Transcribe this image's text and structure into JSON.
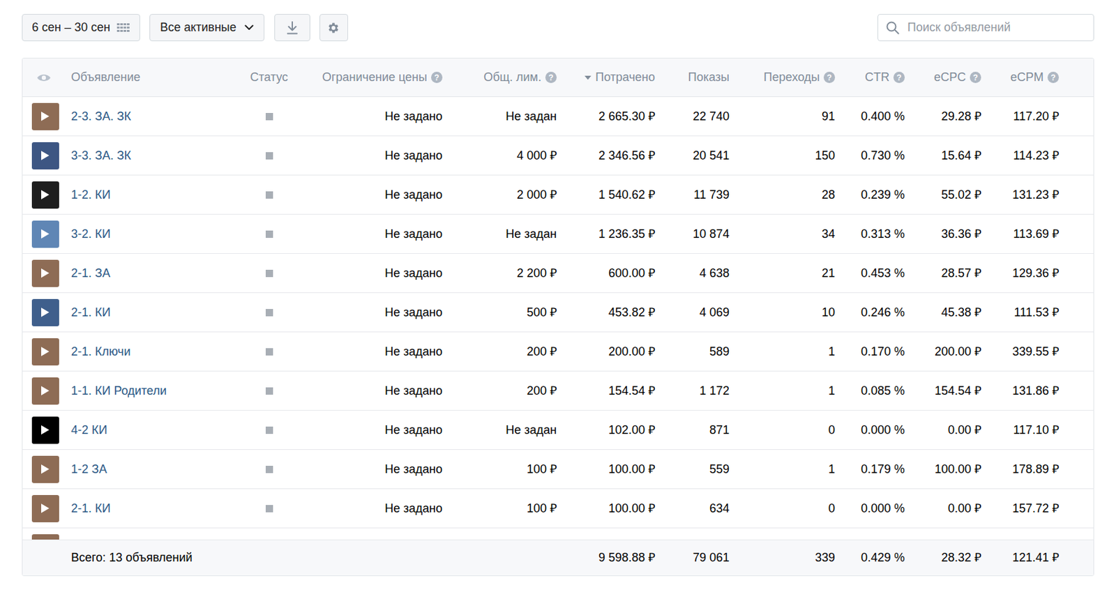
{
  "toolbar": {
    "date_range": "6 сен – 30 сен",
    "filter": "Все активные",
    "search_placeholder": "Поиск объявлений"
  },
  "table": {
    "columns": [
      {
        "label": "",
        "help": null,
        "sorted": false
      },
      {
        "label": "Объявление",
        "help": null,
        "sorted": false
      },
      {
        "label": "Статус",
        "help": null,
        "sorted": false
      },
      {
        "label": "Ограничение цены",
        "help": "?",
        "sorted": false
      },
      {
        "label": "Общ. лим.",
        "help": "?",
        "sorted": false
      },
      {
        "label": "Потрачено",
        "help": null,
        "sorted": true
      },
      {
        "label": "Показы",
        "help": null,
        "sorted": false
      },
      {
        "label": "Переходы",
        "help": "?",
        "sorted": false
      },
      {
        "label": "CTR",
        "help": "?",
        "sorted": false
      },
      {
        "label": "eCPC",
        "help": "?",
        "sorted": false
      },
      {
        "label": "eCPM",
        "help": "?",
        "sorted": false
      }
    ],
    "rows": [
      {
        "thumb_color": "#8e6c55",
        "name": "2-3. ЗА. ЗК",
        "status": "inactive",
        "price_limit": "Не задано",
        "total_limit": "Не задан",
        "spent": "2 665.30 ₽",
        "shows": "22 740",
        "clicks": "91",
        "ctr": "0.400 %",
        "ecpc": "29.28 ₽",
        "ecpm": "117.20 ₽"
      },
      {
        "thumb_color": "#3d5683",
        "name": "3-3. ЗА. ЗК",
        "status": "inactive",
        "price_limit": "Не задано",
        "total_limit": "4 000 ₽",
        "spent": "2 346.56 ₽",
        "shows": "20 541",
        "clicks": "150",
        "ctr": "0.730 %",
        "ecpc": "15.64 ₽",
        "ecpm": "114.23 ₽"
      },
      {
        "thumb_color": "#1e1e1e",
        "name": "1-2. КИ",
        "status": "inactive",
        "price_limit": "Не задано",
        "total_limit": "2 000 ₽",
        "spent": "1 540.62 ₽",
        "shows": "11 739",
        "clicks": "28",
        "ctr": "0.239 %",
        "ecpc": "55.02 ₽",
        "ecpm": "131.23 ₽"
      },
      {
        "thumb_color": "#5f86b5",
        "name": "3-2. КИ",
        "status": "inactive",
        "price_limit": "Не задано",
        "total_limit": "Не задан",
        "spent": "1 236.35 ₽",
        "shows": "10 874",
        "clicks": "34",
        "ctr": "0.313 %",
        "ecpc": "36.36 ₽",
        "ecpm": "113.69 ₽"
      },
      {
        "thumb_color": "#8e6c55",
        "name": "2-1. ЗА",
        "status": "inactive",
        "price_limit": "Не задано",
        "total_limit": "2 200 ₽",
        "spent": "600.00 ₽",
        "shows": "4 638",
        "clicks": "21",
        "ctr": "0.453 %",
        "ecpc": "28.57 ₽",
        "ecpm": "129.36 ₽"
      },
      {
        "thumb_color": "#3f5f8c",
        "name": "2-1. КИ",
        "status": "inactive",
        "price_limit": "Не задано",
        "total_limit": "500 ₽",
        "spent": "453.82 ₽",
        "shows": "4 069",
        "clicks": "10",
        "ctr": "0.246 %",
        "ecpc": "45.38 ₽",
        "ecpm": "111.53 ₽"
      },
      {
        "thumb_color": "#8e6c55",
        "name": "2-1. Ключи",
        "status": "inactive",
        "price_limit": "Не задано",
        "total_limit": "200 ₽",
        "spent": "200.00 ₽",
        "shows": "589",
        "clicks": "1",
        "ctr": "0.170 %",
        "ecpc": "200.00 ₽",
        "ecpm": "339.55 ₽"
      },
      {
        "thumb_color": "#8e6c55",
        "name": "1-1. КИ Родители",
        "status": "inactive",
        "price_limit": "Не задано",
        "total_limit": "200 ₽",
        "spent": "154.54 ₽",
        "shows": "1 172",
        "clicks": "1",
        "ctr": "0.085 %",
        "ecpc": "154.54 ₽",
        "ecpm": "131.86 ₽"
      },
      {
        "thumb_color": "#000000",
        "name": "4-2 КИ",
        "status": "inactive",
        "price_limit": "Не задано",
        "total_limit": "Не задан",
        "spent": "102.00 ₽",
        "shows": "871",
        "clicks": "0",
        "ctr": "0.000 %",
        "ecpc": "0.00 ₽",
        "ecpm": "117.10 ₽"
      },
      {
        "thumb_color": "#8e6c55",
        "name": "1-2 ЗА",
        "status": "inactive",
        "price_limit": "Не задано",
        "total_limit": "100 ₽",
        "spent": "100.00 ₽",
        "shows": "559",
        "clicks": "1",
        "ctr": "0.179 %",
        "ecpc": "100.00 ₽",
        "ecpm": "178.89 ₽"
      },
      {
        "thumb_color": "#8e6c55",
        "name": "2-1. КИ",
        "status": "inactive",
        "price_limit": "Не задано",
        "total_limit": "100 ₽",
        "spent": "100.00 ₽",
        "shows": "634",
        "clicks": "0",
        "ctr": "0.000 %",
        "ecpc": "0.00 ₽",
        "ecpm": "157.72 ₽"
      }
    ],
    "cut_row": {
      "thumb_color": "#8e6c55"
    },
    "footer": {
      "label": "Всего: 13 объявлений",
      "spent": "9 598.88 ₽",
      "shows": "79 061",
      "clicks": "339",
      "ctr": "0.429 %",
      "ecpc": "28.32 ₽",
      "ecpm": "121.41 ₽"
    }
  }
}
